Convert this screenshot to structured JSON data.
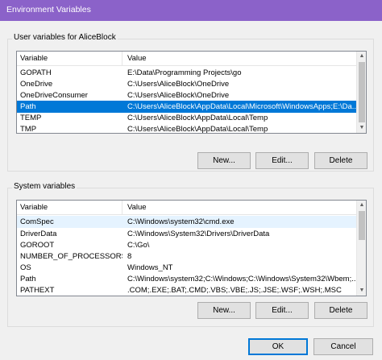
{
  "window": {
    "title": "Environment Variables"
  },
  "user_section": {
    "label": "User variables for AliceBlock",
    "columns": [
      "Variable",
      "Value"
    ],
    "rows": [
      {
        "variable": "GOPATH",
        "value": "E:\\Data\\Programming Projects\\go"
      },
      {
        "variable": "OneDrive",
        "value": "C:\\Users\\AliceBlock\\OneDrive"
      },
      {
        "variable": "OneDriveConsumer",
        "value": "C:\\Users\\AliceBlock\\OneDrive"
      },
      {
        "variable": "Path",
        "value": "C:\\Users\\AliceBlock\\AppData\\Local\\Microsoft\\WindowsApps;E:\\Da..."
      },
      {
        "variable": "TEMP",
        "value": "C:\\Users\\AliceBlock\\AppData\\Local\\Temp"
      },
      {
        "variable": "TMP",
        "value": "C:\\Users\\AliceBlock\\AppData\\Local\\Temp"
      }
    ],
    "selected_variable": "Path",
    "buttons": {
      "new": "New...",
      "edit": "Edit...",
      "delete": "Delete"
    }
  },
  "system_section": {
    "label": "System variables",
    "columns": [
      "Variable",
      "Value"
    ],
    "rows": [
      {
        "variable": "ComSpec",
        "value": "C:\\Windows\\system32\\cmd.exe"
      },
      {
        "variable": "DriverData",
        "value": "C:\\Windows\\System32\\Drivers\\DriverData"
      },
      {
        "variable": "GOROOT",
        "value": "C:\\Go\\"
      },
      {
        "variable": "NUMBER_OF_PROCESSORS",
        "value": "8"
      },
      {
        "variable": "OS",
        "value": "Windows_NT"
      },
      {
        "variable": "Path",
        "value": "C:\\Windows\\system32;C:\\Windows;C:\\Windows\\System32\\Wbem;..."
      },
      {
        "variable": "PATHEXT",
        "value": ".COM;.EXE;.BAT;.CMD;.VBS;.VBE;.JS;.JSE;.WSF;.WSH;.MSC"
      }
    ],
    "highlighted_variable": "ComSpec",
    "buttons": {
      "new": "New...",
      "edit": "Edit...",
      "delete": "Delete"
    }
  },
  "dialog_buttons": {
    "ok": "OK",
    "cancel": "Cancel"
  },
  "colors": {
    "title_bar": "#8b62c9",
    "selection": "#0078d7",
    "hover": "#e5f3ff",
    "default_button_border": "#0078d7"
  },
  "icons": {
    "scroll_up": "triangle-up",
    "scroll_down": "triangle-down"
  }
}
